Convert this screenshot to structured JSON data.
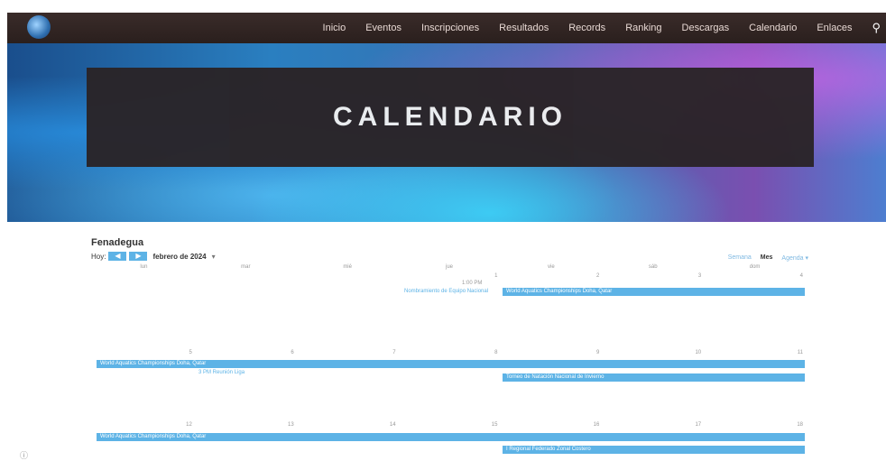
{
  "nav": {
    "items": [
      "Inicio",
      "Eventos",
      "Inscripciones",
      "Resultados",
      "Records",
      "Ranking",
      "Descargas",
      "Calendario",
      "Enlaces"
    ],
    "search_icon": "⚲"
  },
  "hero": {
    "title": "CALENDARIO"
  },
  "calendar": {
    "org": "Fenadegua",
    "today": "Hoy",
    "prev": "◀",
    "next": "▶",
    "month": "febrero de 2024",
    "caret": "▾",
    "views": {
      "week": "Semana",
      "month": "Mes",
      "agenda": "Agenda ▾"
    },
    "dow": [
      "lun",
      "mar",
      "mié",
      "jue",
      "vie",
      "sáb",
      "dom"
    ],
    "week1": [
      "",
      "",
      "",
      "1",
      "2",
      "3",
      "4"
    ],
    "week2": [
      "5",
      "6",
      "7",
      "8",
      "9",
      "10",
      "11"
    ],
    "week3": [
      "12",
      "13",
      "14",
      "15",
      "16",
      "17",
      "18"
    ],
    "events": {
      "e1_time": "1:00 PM",
      "e1": "Nombramiento de Equipo Nacional",
      "e2": "World Aquatics Championships Doha, Qatar",
      "e3": "World Aquatics Championships Doha, Qatar",
      "e4": "3 PM Reunión Liga",
      "e5": "Torneo de Natación Nacional de Invierno",
      "e6": "World Aquatics Championships Doha, Qatar",
      "e7": "I Regional Federado Zonal Costero"
    }
  },
  "info_icon": "ⓘ"
}
